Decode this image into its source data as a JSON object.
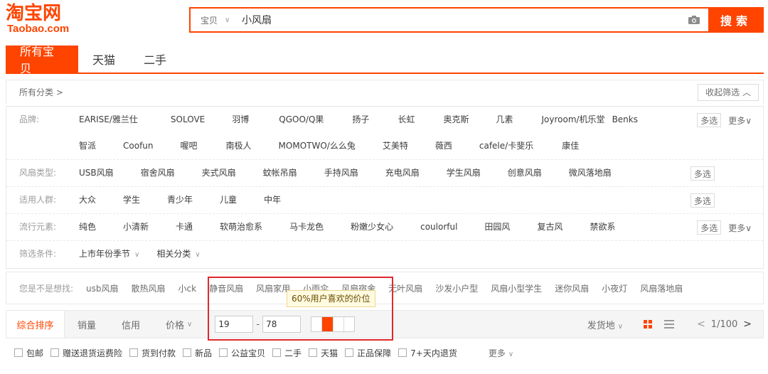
{
  "logo": {
    "cn": "淘宝网",
    "en": "Taobao.com"
  },
  "search": {
    "type": "宝贝",
    "query": "小风扇",
    "button": "搜索"
  },
  "tabs": [
    "所有宝贝",
    "天猫",
    "二手"
  ],
  "category": {
    "all": "所有分类 >",
    "collapse": "收起筛选 ︿"
  },
  "filters": [
    {
      "label": "品牌:",
      "values": [
        "EARISE/雅兰仕",
        "SOLOVE",
        "羽博",
        "QGOO/Q果",
        "扬子",
        "长虹",
        "奥克斯",
        "几素",
        "Joyroom/机乐堂",
        "Benks",
        "智派",
        "Coofun",
        "喔吧",
        "南极人",
        "MOMOTWO/么么兔",
        "艾美特",
        "薇西",
        "cafele/卡斐乐",
        "康佳"
      ],
      "multi": "多选",
      "more": "更多∨"
    },
    {
      "label": "风扇类型:",
      "values": [
        "USB风扇",
        "宿舍风扇",
        "夹式风扇",
        "蚊帐吊扇",
        "手持风扇",
        "充电风扇",
        "学生风扇",
        "创意风扇",
        "微风落地扇"
      ],
      "multi": "多选",
      "more": ""
    },
    {
      "label": "适用人群:",
      "values": [
        "大众",
        "学生",
        "青少年",
        "儿童",
        "中年"
      ],
      "multi": "多选",
      "more": ""
    },
    {
      "label": "流行元素:",
      "values": [
        "纯色",
        "小清新",
        "卡通",
        "软萌治愈系",
        "马卡龙色",
        "粉嫩少女心",
        "coulorful",
        "田园风",
        "复古风",
        "禁欲系"
      ],
      "multi": "多选",
      "more": "更多∨"
    },
    {
      "label": "筛选条件:",
      "dropdowns": [
        "上市年份季节",
        "相关分类"
      ]
    }
  ],
  "suggest": {
    "label": "您是不是想找:",
    "items": [
      "usb风扇",
      "散热风扇",
      "小ck",
      "静音风扇",
      "风扇家用",
      "小雨伞",
      "风扇宿舍",
      "无叶风扇",
      "沙发小户型",
      "风扇小型学生",
      "迷你风扇",
      "小夜灯",
      "风扇落地扇"
    ]
  },
  "sort": {
    "items": [
      "综合排序",
      "销量",
      "信用",
      "价格"
    ],
    "price_min": "19",
    "price_max": "78",
    "tooltip": "60%用户喜欢的价位",
    "ship": "发货地",
    "page": "1/100"
  },
  "checks": [
    "包邮",
    "赠送退货运费险",
    "货到付款",
    "新品",
    "公益宝贝",
    "二手",
    "天猫",
    "正品保障",
    "7+天内退货"
  ],
  "checks_more": "更多"
}
